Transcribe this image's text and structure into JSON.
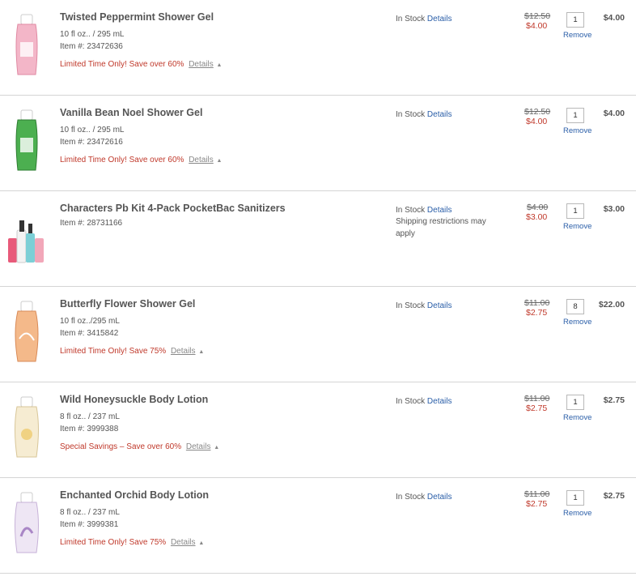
{
  "items": [
    {
      "name": "Twisted Peppermint Shower Gel",
      "size": "10 fl oz.. / 295 mL",
      "item_no": "Item #: 23472636",
      "promo": "Limited Time Only! Save over 60%",
      "promo_details": "Details",
      "stock": "In Stock",
      "stock_details": "Details",
      "restriction": "",
      "price_old": "$12.50",
      "price_new": "$4.00",
      "qty": "1",
      "remove": "Remove",
      "total": "$4.00",
      "bottle_color": "#f3b6c8",
      "cap_color": "#ffffff"
    },
    {
      "name": "Vanilla Bean Noel Shower Gel",
      "size": "10 fl oz.. / 295 mL",
      "item_no": "Item #: 23472616",
      "promo": "Limited Time Only! Save over 60%",
      "promo_details": "Details",
      "stock": "In Stock",
      "stock_details": "Details",
      "restriction": "",
      "price_old": "$12.50",
      "price_new": "$4.00",
      "qty": "1",
      "remove": "Remove",
      "total": "$4.00",
      "bottle_color": "#4caf50",
      "cap_color": "#ffffff"
    },
    {
      "name": "Characters Pb Kit 4-Pack PocketBac Sanitizers",
      "size": "",
      "item_no": "Item #: 28731166",
      "promo": "",
      "promo_details": "",
      "stock": "In Stock",
      "stock_details": "Details",
      "restriction": "Shipping restrictions may apply",
      "price_old": "$4.00",
      "price_new": "$3.00",
      "qty": "1",
      "remove": "Remove",
      "total": "$3.00",
      "bottle_color": "#e85a7a",
      "cap_color": "#333333"
    },
    {
      "name": "Butterfly Flower Shower Gel",
      "size": "10 fl oz../295 mL",
      "item_no": "Item #: 3415842",
      "promo": "Limited Time Only! Save 75%",
      "promo_details": "Details",
      "stock": "In Stock",
      "stock_details": "Details",
      "restriction": "",
      "price_old": "$11.00",
      "price_new": "$2.75",
      "qty": "8",
      "remove": "Remove",
      "total": "$22.00",
      "bottle_color": "#f4b98a",
      "cap_color": "#ffffff"
    },
    {
      "name": "Wild Honeysuckle Body Lotion",
      "size": "8 fl oz.. / 237 mL",
      "item_no": "Item #: 3999388",
      "promo": "Special Savings – Save over 60%",
      "promo_details": "Details",
      "stock": "In Stock",
      "stock_details": "Details",
      "restriction": "",
      "price_old": "$11.00",
      "price_new": "$2.75",
      "qty": "1",
      "remove": "Remove",
      "total": "$2.75",
      "bottle_color": "#f3e6c6",
      "cap_color": "#ffffff"
    },
    {
      "name": "Enchanted Orchid Body Lotion",
      "size": "8 fl oz.. / 237 mL",
      "item_no": "Item #: 3999381",
      "promo": "Limited Time Only! Save 75%",
      "promo_details": "Details",
      "stock": "In Stock",
      "stock_details": "Details",
      "restriction": "",
      "price_old": "$11.00",
      "price_new": "$2.75",
      "qty": "1",
      "remove": "Remove",
      "total": "$2.75",
      "bottle_color": "#d9c6e6",
      "cap_color": "#ffffff"
    }
  ]
}
